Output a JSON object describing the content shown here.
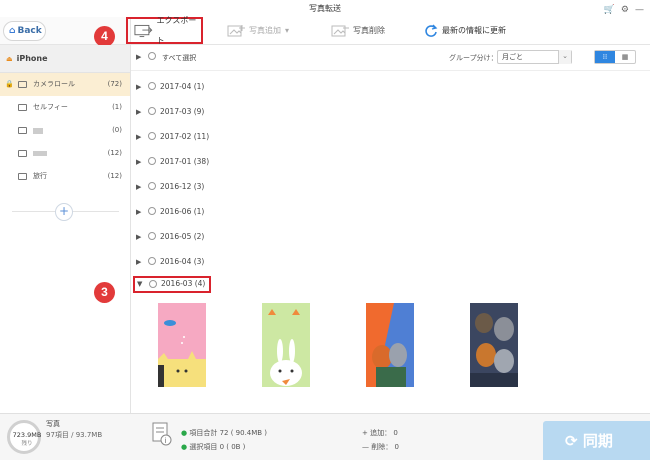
{
  "window": {
    "title": "写真転送"
  },
  "nav": {
    "back_label": "Back"
  },
  "toolbar": {
    "export_label": "エクスポート",
    "add_label": "写真追加",
    "delete_label": "写真削除",
    "refresh_label": "最新の情報に更新"
  },
  "annotations": {
    "step_export": "4",
    "step_group": "3"
  },
  "sidebar": {
    "device": "iPhone",
    "items": [
      {
        "label": "カメラロール",
        "count": "(72)",
        "active": true
      },
      {
        "label": "セルフィー",
        "count": "(1)"
      },
      {
        "label": "",
        "count": "(0)"
      },
      {
        "label": "",
        "count": "(12)"
      },
      {
        "label": "旅行",
        "count": "(12)"
      }
    ]
  },
  "list": {
    "select_all": "すべて選択",
    "group_by_label": "グループ分け：",
    "group_by_value": "月ごと",
    "groups": [
      {
        "label": "2017-04 (1)"
      },
      {
        "label": "2017-03 (9)"
      },
      {
        "label": "2017-02 (11)"
      },
      {
        "label": "2017-01 (38)"
      },
      {
        "label": "2016-12 (3)"
      },
      {
        "label": "2016-06 (1)"
      },
      {
        "label": "2016-05 (2)"
      },
      {
        "label": "2016-04 (3)"
      },
      {
        "label": "2016-03 (4)",
        "expanded": true
      }
    ]
  },
  "footer": {
    "storage_value": "723.9MB",
    "storage_sub": "残り",
    "category": "写真",
    "category_detail": "97項目 / 93.7MB",
    "total_items": "項目合計 72 ( 90.4MB )",
    "selected_items": "選択項目 0 ( 0B )",
    "added": "追加： 0",
    "deleted": "削除： 0",
    "sync_label": "同期"
  },
  "colors": {
    "accent": "#2f86e0",
    "annotation_red": "#e23a3a",
    "active_row": "#fbeed3",
    "sync_button": "#b8d9f1"
  }
}
